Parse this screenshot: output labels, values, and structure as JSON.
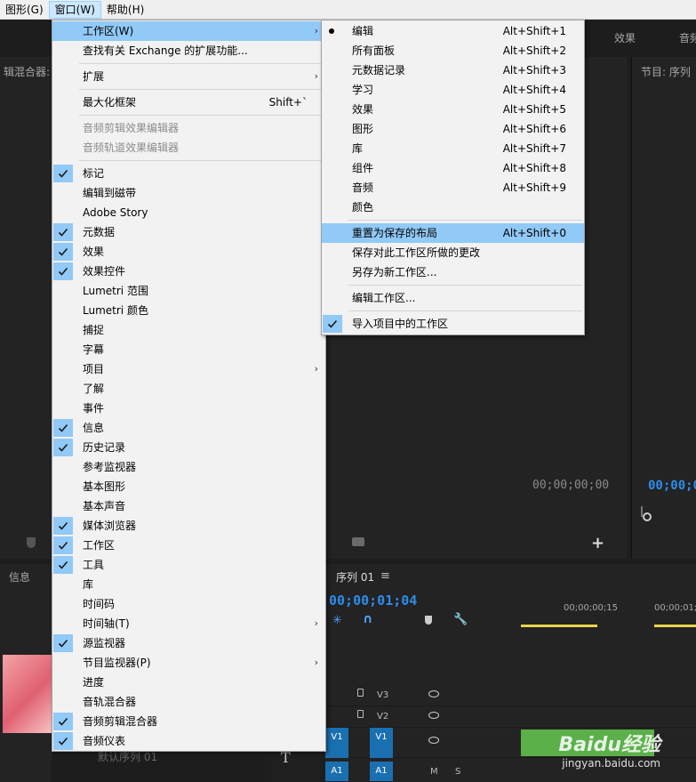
{
  "menubar": [
    {
      "label": "图形(G)",
      "open": false
    },
    {
      "label": "窗口(W)",
      "open": true
    },
    {
      "label": "帮助(H)",
      "open": false
    }
  ],
  "background": {
    "left_panel_title": "辑混合器:",
    "right_tab_effects": "效果",
    "right_tab_audio": "音频",
    "program_title": "节目: 序列",
    "source_timecode": "00;00;00;00",
    "program_timecode": "00;00;0",
    "info_tab": "信息",
    "sequence_tab": "序列 01",
    "timeline_timecode": "00;00;01;04",
    "ruler_1": "00;00;00;15",
    "ruler_2": "00;00;01;",
    "tracks": [
      "V3",
      "V2",
      "V1",
      "A1"
    ],
    "track_header_v1": "V1",
    "track_header_a1": "A1",
    "bottom_label": "默认序列 01",
    "watermark_brand": "Baidu经验",
    "watermark_url": "jingyan.baidu.com"
  },
  "window_menu": [
    {
      "label": "工作区(W)",
      "type": "submenu",
      "highlight": true
    },
    {
      "label": "查找有关 Exchange 的扩展功能..."
    },
    {
      "type": "sep"
    },
    {
      "label": "扩展",
      "type": "submenu"
    },
    {
      "type": "sep"
    },
    {
      "label": "最大化框架",
      "shortcut": "Shift+`"
    },
    {
      "type": "sep"
    },
    {
      "label": "音频剪辑效果编辑器",
      "disabled": true
    },
    {
      "label": "音频轨道效果编辑器",
      "disabled": true
    },
    {
      "type": "sep"
    },
    {
      "label": "标记",
      "checked": true
    },
    {
      "label": "编辑到磁带"
    },
    {
      "label": "Adobe Story"
    },
    {
      "label": "元数据",
      "checked": true
    },
    {
      "label": "效果",
      "checked": true
    },
    {
      "label": "效果控件",
      "checked": true
    },
    {
      "label": "Lumetri 范围"
    },
    {
      "label": "Lumetri 颜色"
    },
    {
      "label": "捕捉"
    },
    {
      "label": "字幕"
    },
    {
      "label": "项目",
      "type": "submenu"
    },
    {
      "label": "了解"
    },
    {
      "label": "事件"
    },
    {
      "label": "信息",
      "checked": true
    },
    {
      "label": "历史记录",
      "checked": true
    },
    {
      "label": "参考监视器"
    },
    {
      "label": "基本图形"
    },
    {
      "label": "基本声音"
    },
    {
      "label": "媒体浏览器",
      "checked": true
    },
    {
      "label": "工作区",
      "checked": true
    },
    {
      "label": "工具",
      "checked": true
    },
    {
      "label": "库"
    },
    {
      "label": "时间码"
    },
    {
      "label": "时间轴(T)",
      "type": "submenu"
    },
    {
      "label": "源监视器",
      "checked": true
    },
    {
      "label": "节目监视器(P)",
      "type": "submenu"
    },
    {
      "label": "进度"
    },
    {
      "label": "音轨混合器"
    },
    {
      "label": "音频剪辑混合器",
      "checked": true
    },
    {
      "label": "音频仪表",
      "checked": true
    }
  ],
  "workspace_menu": [
    {
      "label": "编辑",
      "shortcut": "Alt+Shift+1",
      "bullet": true
    },
    {
      "label": "所有面板",
      "shortcut": "Alt+Shift+2"
    },
    {
      "label": "元数据记录",
      "shortcut": "Alt+Shift+3"
    },
    {
      "label": "学习",
      "shortcut": "Alt+Shift+4"
    },
    {
      "label": "效果",
      "shortcut": "Alt+Shift+5"
    },
    {
      "label": "图形",
      "shortcut": "Alt+Shift+6"
    },
    {
      "label": "库",
      "shortcut": "Alt+Shift+7"
    },
    {
      "label": "组件",
      "shortcut": "Alt+Shift+8"
    },
    {
      "label": "音频",
      "shortcut": "Alt+Shift+9"
    },
    {
      "label": "颜色"
    },
    {
      "type": "sep"
    },
    {
      "label": "重置为保存的布局",
      "shortcut": "Alt+Shift+0",
      "highlight": true
    },
    {
      "label": "保存对此工作区所做的更改"
    },
    {
      "label": "另存为新工作区..."
    },
    {
      "type": "sep"
    },
    {
      "label": "编辑工作区..."
    },
    {
      "type": "sep"
    },
    {
      "label": "导入项目中的工作区",
      "checked": true
    }
  ]
}
